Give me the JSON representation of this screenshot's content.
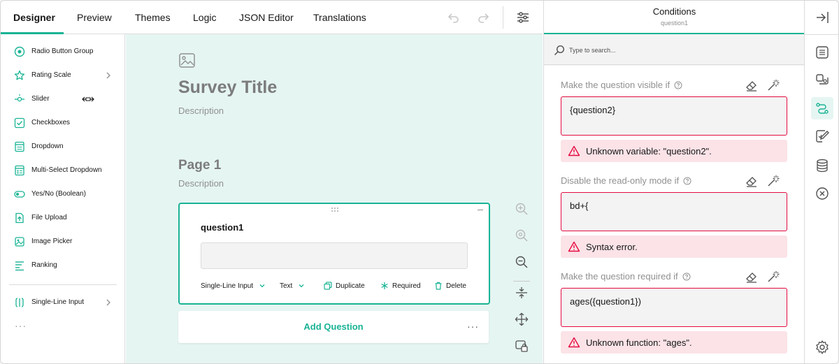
{
  "topbar": {
    "tabs": [
      {
        "label": "Designer",
        "active": true
      },
      {
        "label": "Preview"
      },
      {
        "label": "Themes"
      },
      {
        "label": "Logic"
      },
      {
        "label": "JSON Editor"
      },
      {
        "label": "Translations"
      }
    ],
    "icons": [
      "undo-icon",
      "redo-icon",
      "settings-sliders-icon"
    ]
  },
  "toolbox": {
    "items": [
      {
        "label": "Radio Button Group",
        "icon": "radio-icon"
      },
      {
        "label": "Rating Scale",
        "icon": "rating-icon",
        "has_submenu": true
      },
      {
        "label": "Slider",
        "icon": "slider-icon"
      },
      {
        "label": "Checkboxes",
        "icon": "checkbox-icon"
      },
      {
        "label": "Dropdown",
        "icon": "dropdown-icon"
      },
      {
        "label": "Multi-Select Dropdown",
        "icon": "multi-dropdown-icon"
      },
      {
        "label": "Yes/No (Boolean)",
        "icon": "toggle-icon"
      },
      {
        "label": "File Upload",
        "icon": "file-upload-icon"
      },
      {
        "label": "Image Picker",
        "icon": "image-picker-icon"
      },
      {
        "label": "Ranking",
        "icon": "ranking-icon"
      },
      {
        "label": "Single-Line Input",
        "icon": "text-input-icon",
        "has_submenu": true
      }
    ],
    "more": "···"
  },
  "canvas": {
    "survey_title": "Survey Title",
    "survey_description": "Description",
    "page_title": "Page 1",
    "page_description": "Description",
    "question": {
      "name": "question1",
      "type_label": "Single-Line Input",
      "input_type_label": "Text",
      "duplicate_label": "Duplicate",
      "required_label": "Required",
      "delete_label": "Delete"
    },
    "add_question_label": "Add Question",
    "add_more": "···"
  },
  "conditions_panel": {
    "title": "Conditions",
    "subtitle": "question1",
    "search_placeholder": "Type to search...",
    "conditions": [
      {
        "label": "Make the question visible if",
        "value": "{question2}",
        "error": "Unknown variable: \"question2\"."
      },
      {
        "label": "Disable the read-only mode if",
        "value": "bd+{",
        "error": "Syntax error."
      },
      {
        "label": "Make the question required if",
        "value": "ages({question1})",
        "error": "Unknown function: \"ages\"."
      }
    ]
  },
  "colors": {
    "accent": "#19b394",
    "canvas_bg": "#e5f5f2",
    "error_border": "#e50a3e",
    "error_bg": "#fbe3e8"
  }
}
